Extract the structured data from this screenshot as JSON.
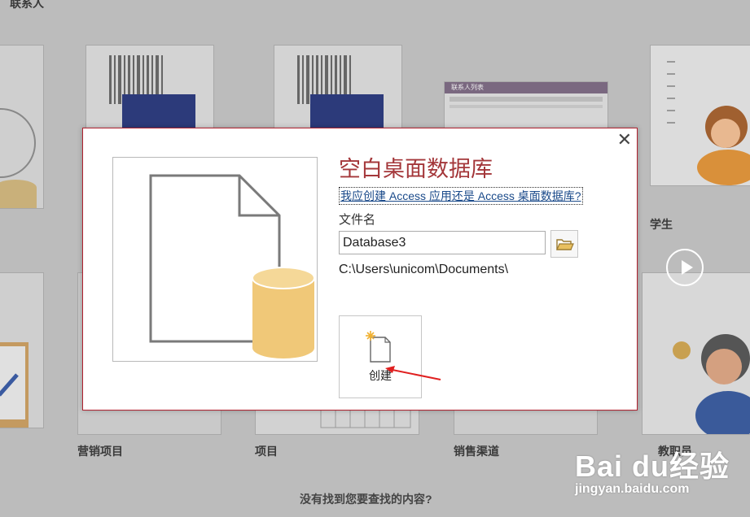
{
  "background": {
    "top_label": "联系人",
    "tiles": [
      {
        "label": ""
      },
      {
        "label": "营销项目"
      },
      {
        "label": "项目"
      },
      {
        "label": "销售渠道"
      },
      {
        "label": "学生"
      },
      {
        "label": "教职员"
      }
    ],
    "contacts_list_title": "联系人列表",
    "bottom_prompt": "没有找到您要查找的内容?"
  },
  "dialog": {
    "title": "空白桌面数据库",
    "help_link": "我应创建 Access 应用还是 Access 桌面数据库?",
    "file_name_label": "文件名",
    "file_name_value": "Database3",
    "path": "C:\\Users\\unicom\\Documents\\",
    "create_label": "创建",
    "close_icon": "close-icon",
    "browse_icon": "folder-icon"
  },
  "watermark": {
    "logo": "Bai du经验",
    "url": "jingyan.baidu.com"
  },
  "colors": {
    "accent": "#a4373a",
    "link": "#1a4a8a",
    "db_cylinder": "#f0c878"
  }
}
